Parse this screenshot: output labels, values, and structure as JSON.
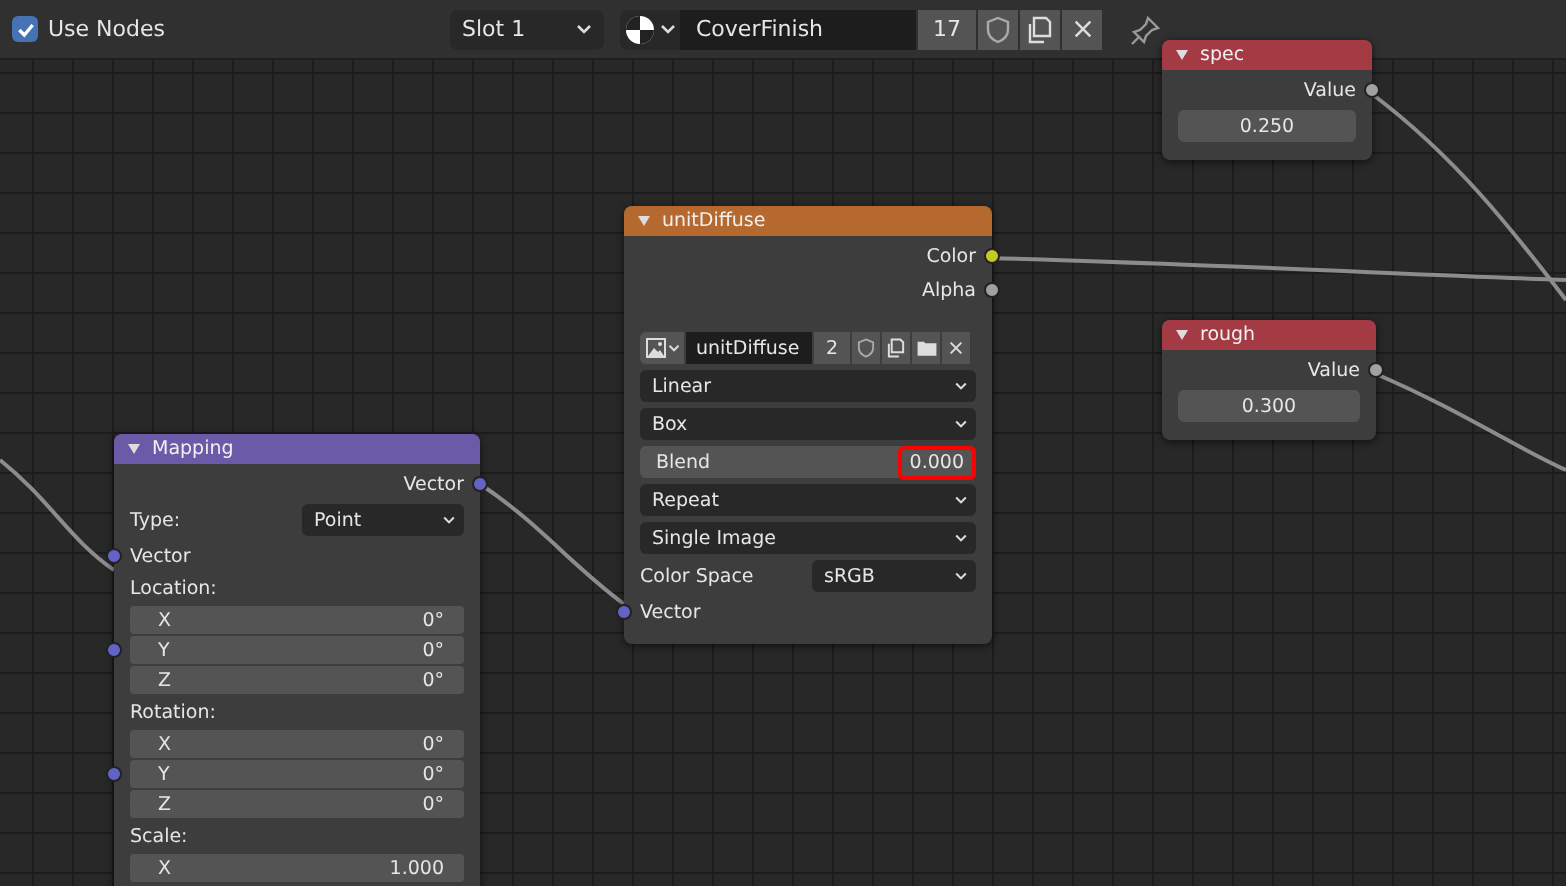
{
  "toolbar": {
    "use_nodes": {
      "label": "Use Nodes",
      "checked": true
    },
    "slot": "Slot 1",
    "material": "CoverFinish",
    "user_count": "17"
  },
  "nodes": [
    {
      "title": "spec",
      "color": "#a33a44",
      "rows": [
        {
          "kind": "output",
          "label": "Value",
          "color": "#a1a1a1"
        },
        {
          "kind": "number",
          "value": "0.250"
        }
      ]
    },
    {
      "title": "rough",
      "color": "#a33a44",
      "rows": [
        {
          "kind": "output",
          "label": "Value",
          "color": "#a1a1a1"
        },
        {
          "kind": "number",
          "value": "0.300"
        }
      ]
    },
    {
      "title": "unitDiffuse",
      "color": "#b5692f",
      "rows": [
        {
          "kind": "output",
          "label": "Color",
          "color": "#c7c729"
        },
        {
          "kind": "output",
          "label": "Alpha",
          "color": "#a1a1a1"
        },
        {
          "kind": "image",
          "name": "unitDiffuse",
          "users": "2"
        },
        {
          "kind": "dropdown",
          "value": "Linear"
        },
        {
          "kind": "dropdown",
          "value": "Box"
        },
        {
          "kind": "slider",
          "label": "Blend",
          "value": "0.000",
          "highlighted": true
        },
        {
          "kind": "dropdown",
          "value": "Repeat"
        },
        {
          "kind": "dropdown",
          "value": "Single Image"
        },
        {
          "kind": "labeled_dropdown",
          "label": "Color Space",
          "value": "sRGB"
        },
        {
          "kind": "input",
          "label": "Vector",
          "color": "#6363c7"
        }
      ]
    },
    {
      "title": "Mapping",
      "color": "#6b5aa8",
      "rows": [
        {
          "kind": "output",
          "label": "Vector",
          "color": "#6363c7"
        },
        {
          "kind": "labeled_dropdown",
          "label": "Type:",
          "value": "Point"
        },
        {
          "kind": "input",
          "label": "Vector",
          "color": "#6363c7"
        },
        {
          "kind": "label",
          "label": "Location:"
        },
        {
          "kind": "vector",
          "color": "#6363c7",
          "fields": [
            {
              "axis": "X",
              "value": "0°"
            },
            {
              "axis": "Y",
              "value": "0°"
            },
            {
              "axis": "Z",
              "value": "0°"
            }
          ]
        },
        {
          "kind": "label",
          "label": "Rotation:"
        },
        {
          "kind": "vector",
          "color": "#6363c7",
          "fields": [
            {
              "axis": "X",
              "value": "0°"
            },
            {
              "axis": "Y",
              "value": "0°"
            },
            {
              "axis": "Z",
              "value": "0°"
            }
          ]
        },
        {
          "kind": "label",
          "label": "Scale:"
        },
        {
          "kind": "vector",
          "fields": [
            {
              "axis": "X",
              "value": "1.000"
            }
          ]
        }
      ]
    }
  ]
}
